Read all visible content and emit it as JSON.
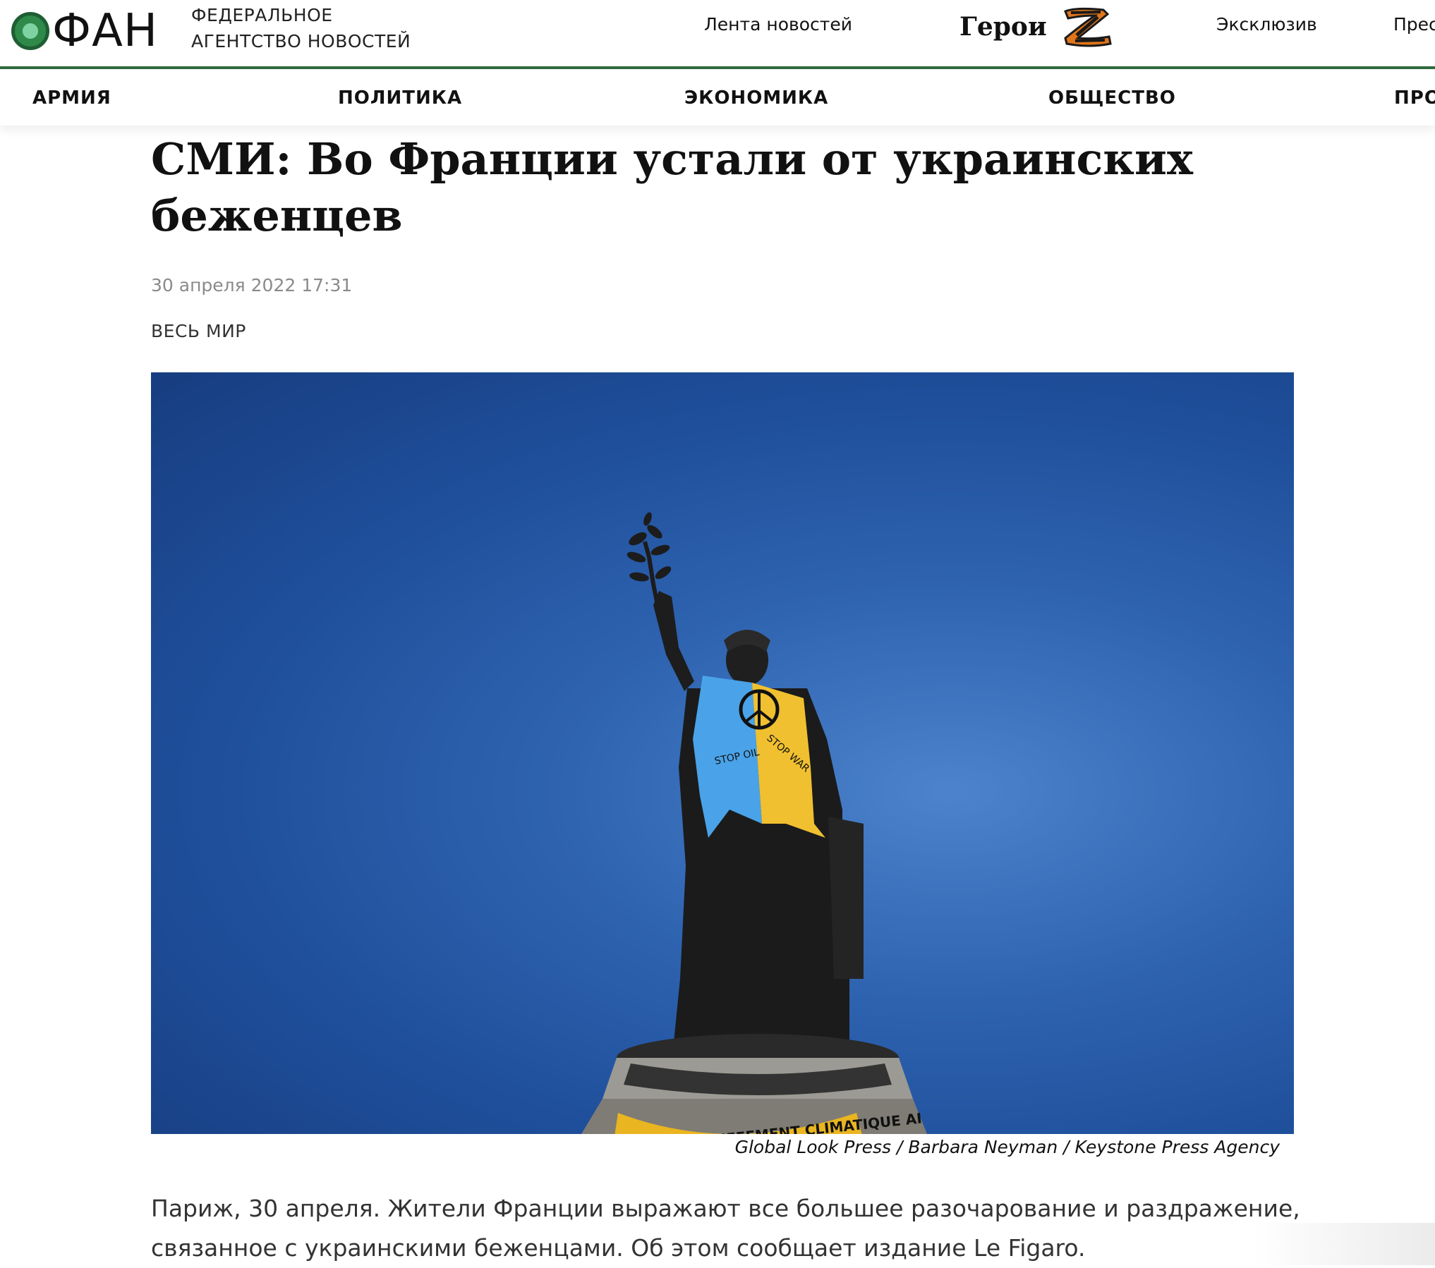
{
  "header": {
    "logo_text": "ФАН",
    "logo_subtitle_line1": "ФЕДЕРАЛЬНОЕ",
    "logo_subtitle_line2": "АГЕНТСТВО НОВОСТЕЙ",
    "nav": {
      "news_feed": "Лента новостей",
      "heroes": "Герои",
      "exclusive": "Эксклюзив",
      "press_cut": "Прес"
    },
    "accent_color": "#2e6b3e"
  },
  "categories": [
    "АРМИЯ",
    "ПОЛИТИКА",
    "ЭКОНОМИКА",
    "ОБЩЕСТВО",
    "ПРО"
  ],
  "article": {
    "title": "СМИ: Во Франции устали от украинских беженцев",
    "date": "30 апреля 2022 17:31",
    "rubric": "ВЕСЬ МИР",
    "photo": {
      "icon": "statue-photo",
      "shirt_text_left": "STOP OIL",
      "shirt_text_right": "STOP WAR",
      "banner_text": "LE RECHAUFFEMENT CLIMATIQUE AI",
      "credit": "Global Look Press / Barbara Neyman / Keystone Press Agency"
    },
    "lead": "Париж, 30 апреля. Жители Франции выражают все большее разочарование и раздражение, связанное с украинскими беженцами. Об этом сообщает издание Le Figaro."
  }
}
